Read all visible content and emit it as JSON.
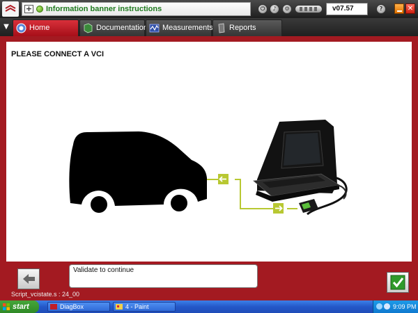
{
  "banner": {
    "title": "Information banner instructions",
    "plus_glyph": "+",
    "version": "v07.57",
    "help_glyph": "?",
    "close_glyph": "✕"
  },
  "tabs": [
    {
      "label": "Home",
      "icon": "home-icon",
      "active": true
    },
    {
      "label": "Documentation",
      "icon": "documentation-icon",
      "active": false
    },
    {
      "label": "Measurements",
      "icon": "measurements-icon",
      "active": false
    },
    {
      "label": "Reports",
      "icon": "reports-icon",
      "active": false
    }
  ],
  "main": {
    "title": "PLEASE CONNECT A VCI",
    "message": "Validate to continue",
    "script_label": "Script_vcistate.s : 24_00"
  },
  "taskbar": {
    "start_label": "start",
    "tasks": [
      {
        "label": "DiagBox"
      },
      {
        "label": "4 - Paint"
      }
    ],
    "clock": "9:09 PM"
  },
  "colors": {
    "frame_red": "#a31a21",
    "active_tab": "#c21d27",
    "banner_text": "#1e7a1e",
    "connector_green": "#b8c832",
    "validate_green": "#2f9a2a"
  }
}
